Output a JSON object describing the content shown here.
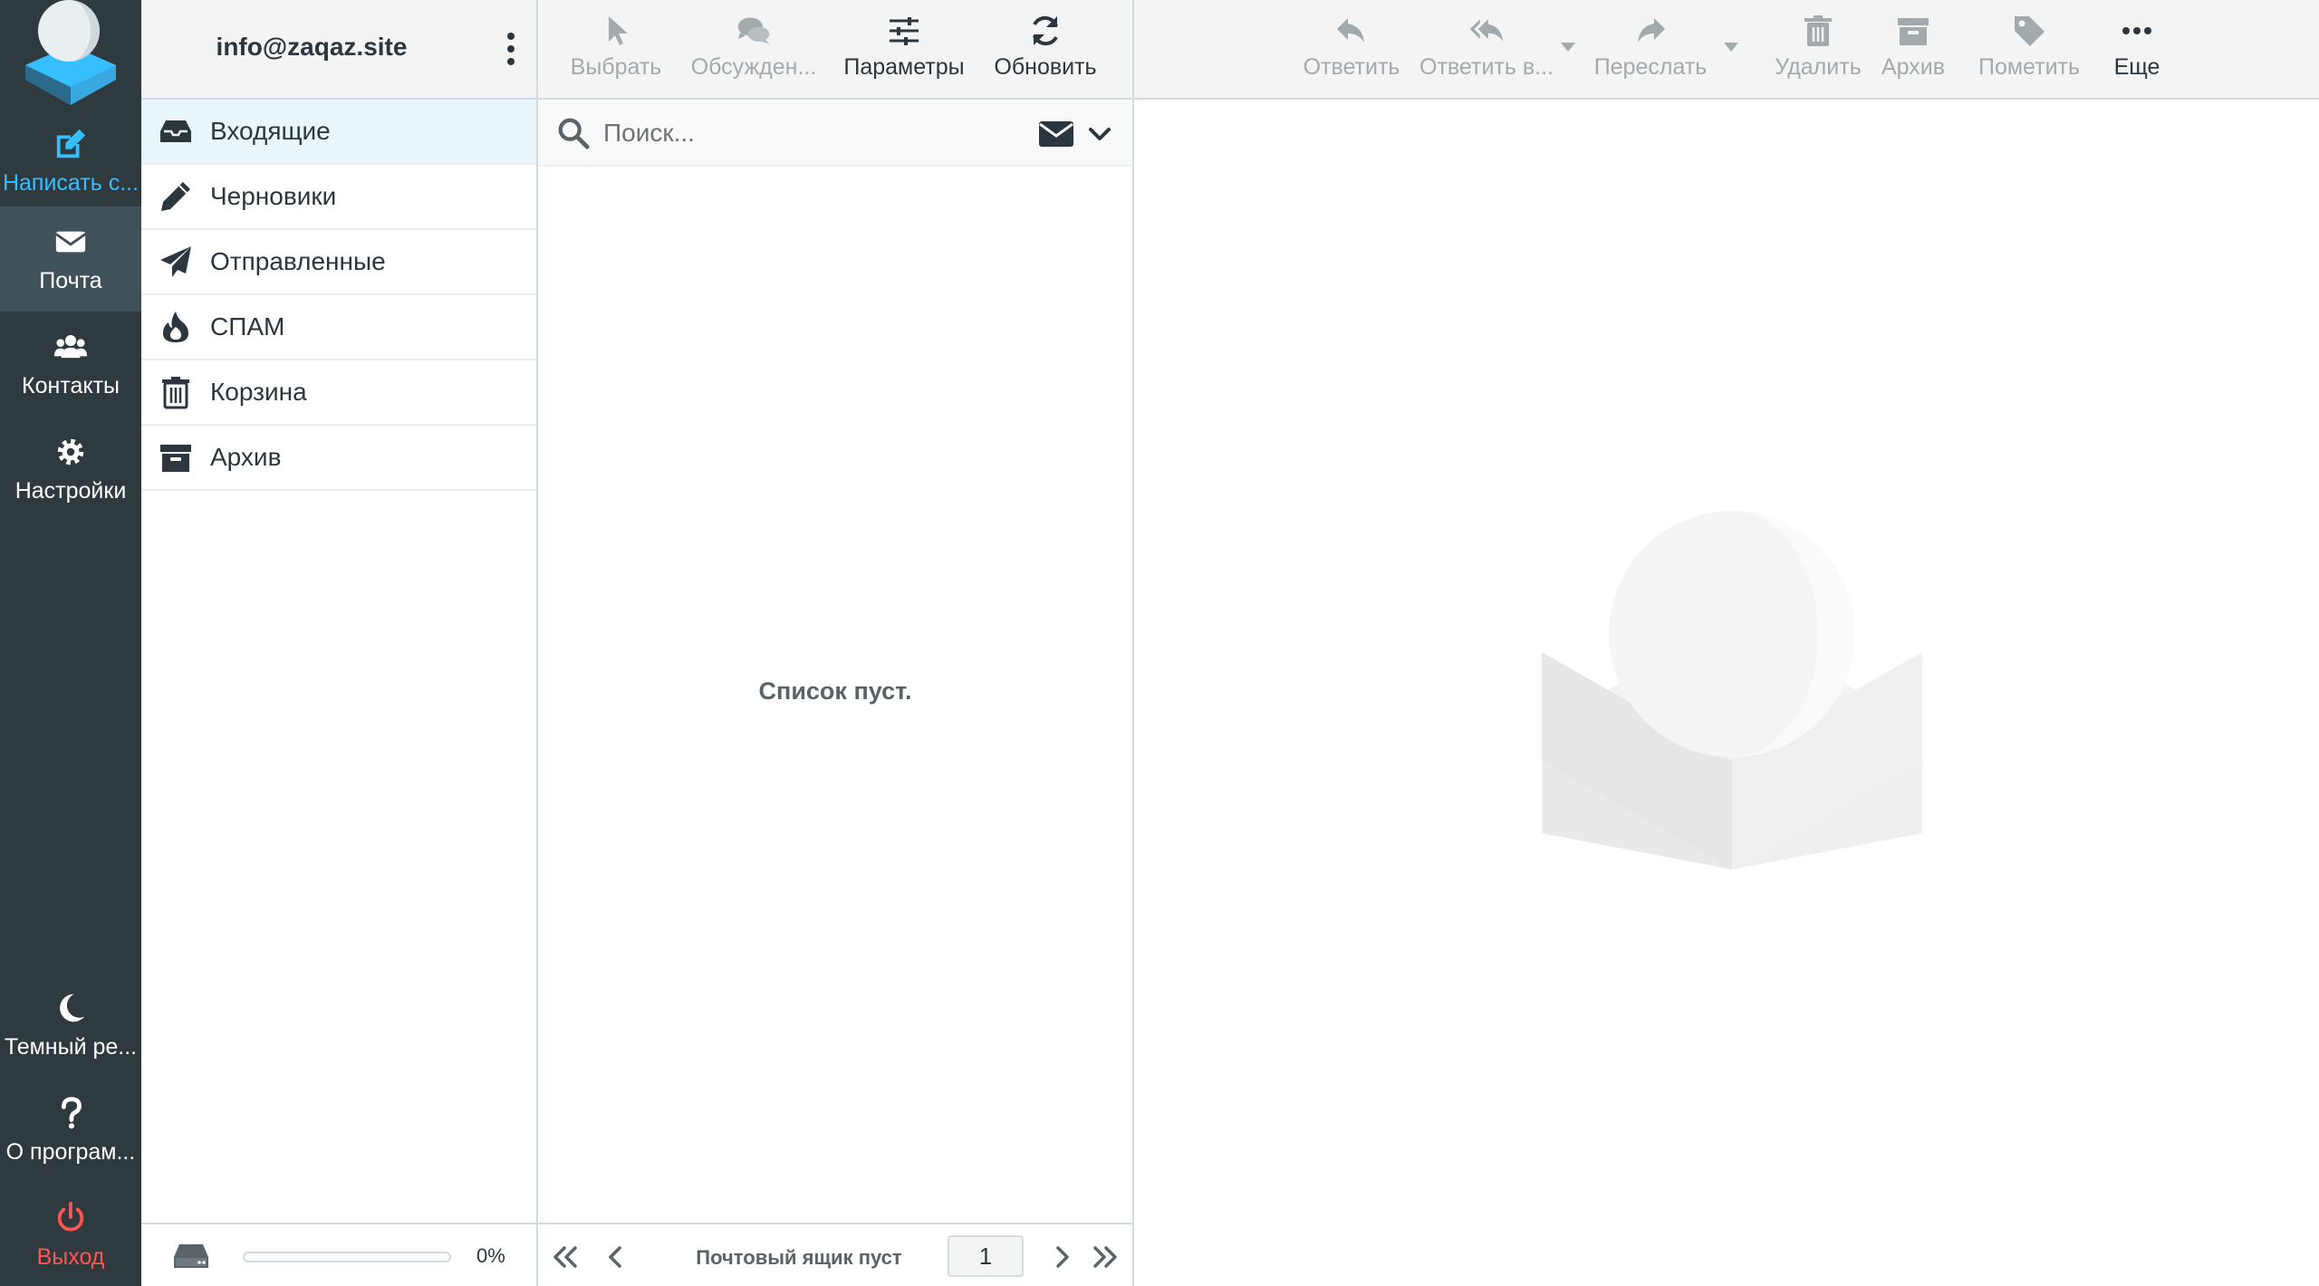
{
  "rail": {
    "compose_label": "Написать с...",
    "mail_label": "Почта",
    "contacts_label": "Контакты",
    "settings_label": "Настройки",
    "darkmode_label": "Темный ре...",
    "about_label": "О програм...",
    "logout_label": "Выход"
  },
  "account": {
    "email": "info@zaqaz.site"
  },
  "folders": [
    {
      "label": "Входящие",
      "icon": "inbox-icon",
      "active": true
    },
    {
      "label": "Черновики",
      "icon": "pencil-icon",
      "active": false
    },
    {
      "label": "Отправленные",
      "icon": "paper-plane-icon",
      "active": false
    },
    {
      "label": "СПАМ",
      "icon": "fire-icon",
      "active": false
    },
    {
      "label": "Корзина",
      "icon": "trash-icon",
      "active": false
    },
    {
      "label": "Архив",
      "icon": "archive-icon",
      "active": false
    }
  ],
  "quota": {
    "percent_label": "0%",
    "percent": 0
  },
  "list_toolbar": {
    "select_label": "Выбрать",
    "threads_label": "Обсужден...",
    "options_label": "Параметры",
    "refresh_label": "Обновить"
  },
  "search": {
    "placeholder": "Поиск..."
  },
  "list": {
    "empty_message": "Список пуст."
  },
  "pager": {
    "status": "Почтовый ящик пуст",
    "page": "1"
  },
  "message_toolbar": {
    "reply_label": "Ответить",
    "reply_all_label": "Ответить в...",
    "forward_label": "Переслать",
    "delete_label": "Удалить",
    "archive_label": "Архив",
    "mark_label": "Пометить",
    "more_label": "Еще"
  },
  "colors": {
    "rail_bg": "#2f3a3f",
    "rail_active": "#41515a",
    "accent": "#37beff",
    "logout": "#ff5552",
    "folder_active_bg": "#e9f6fc"
  }
}
